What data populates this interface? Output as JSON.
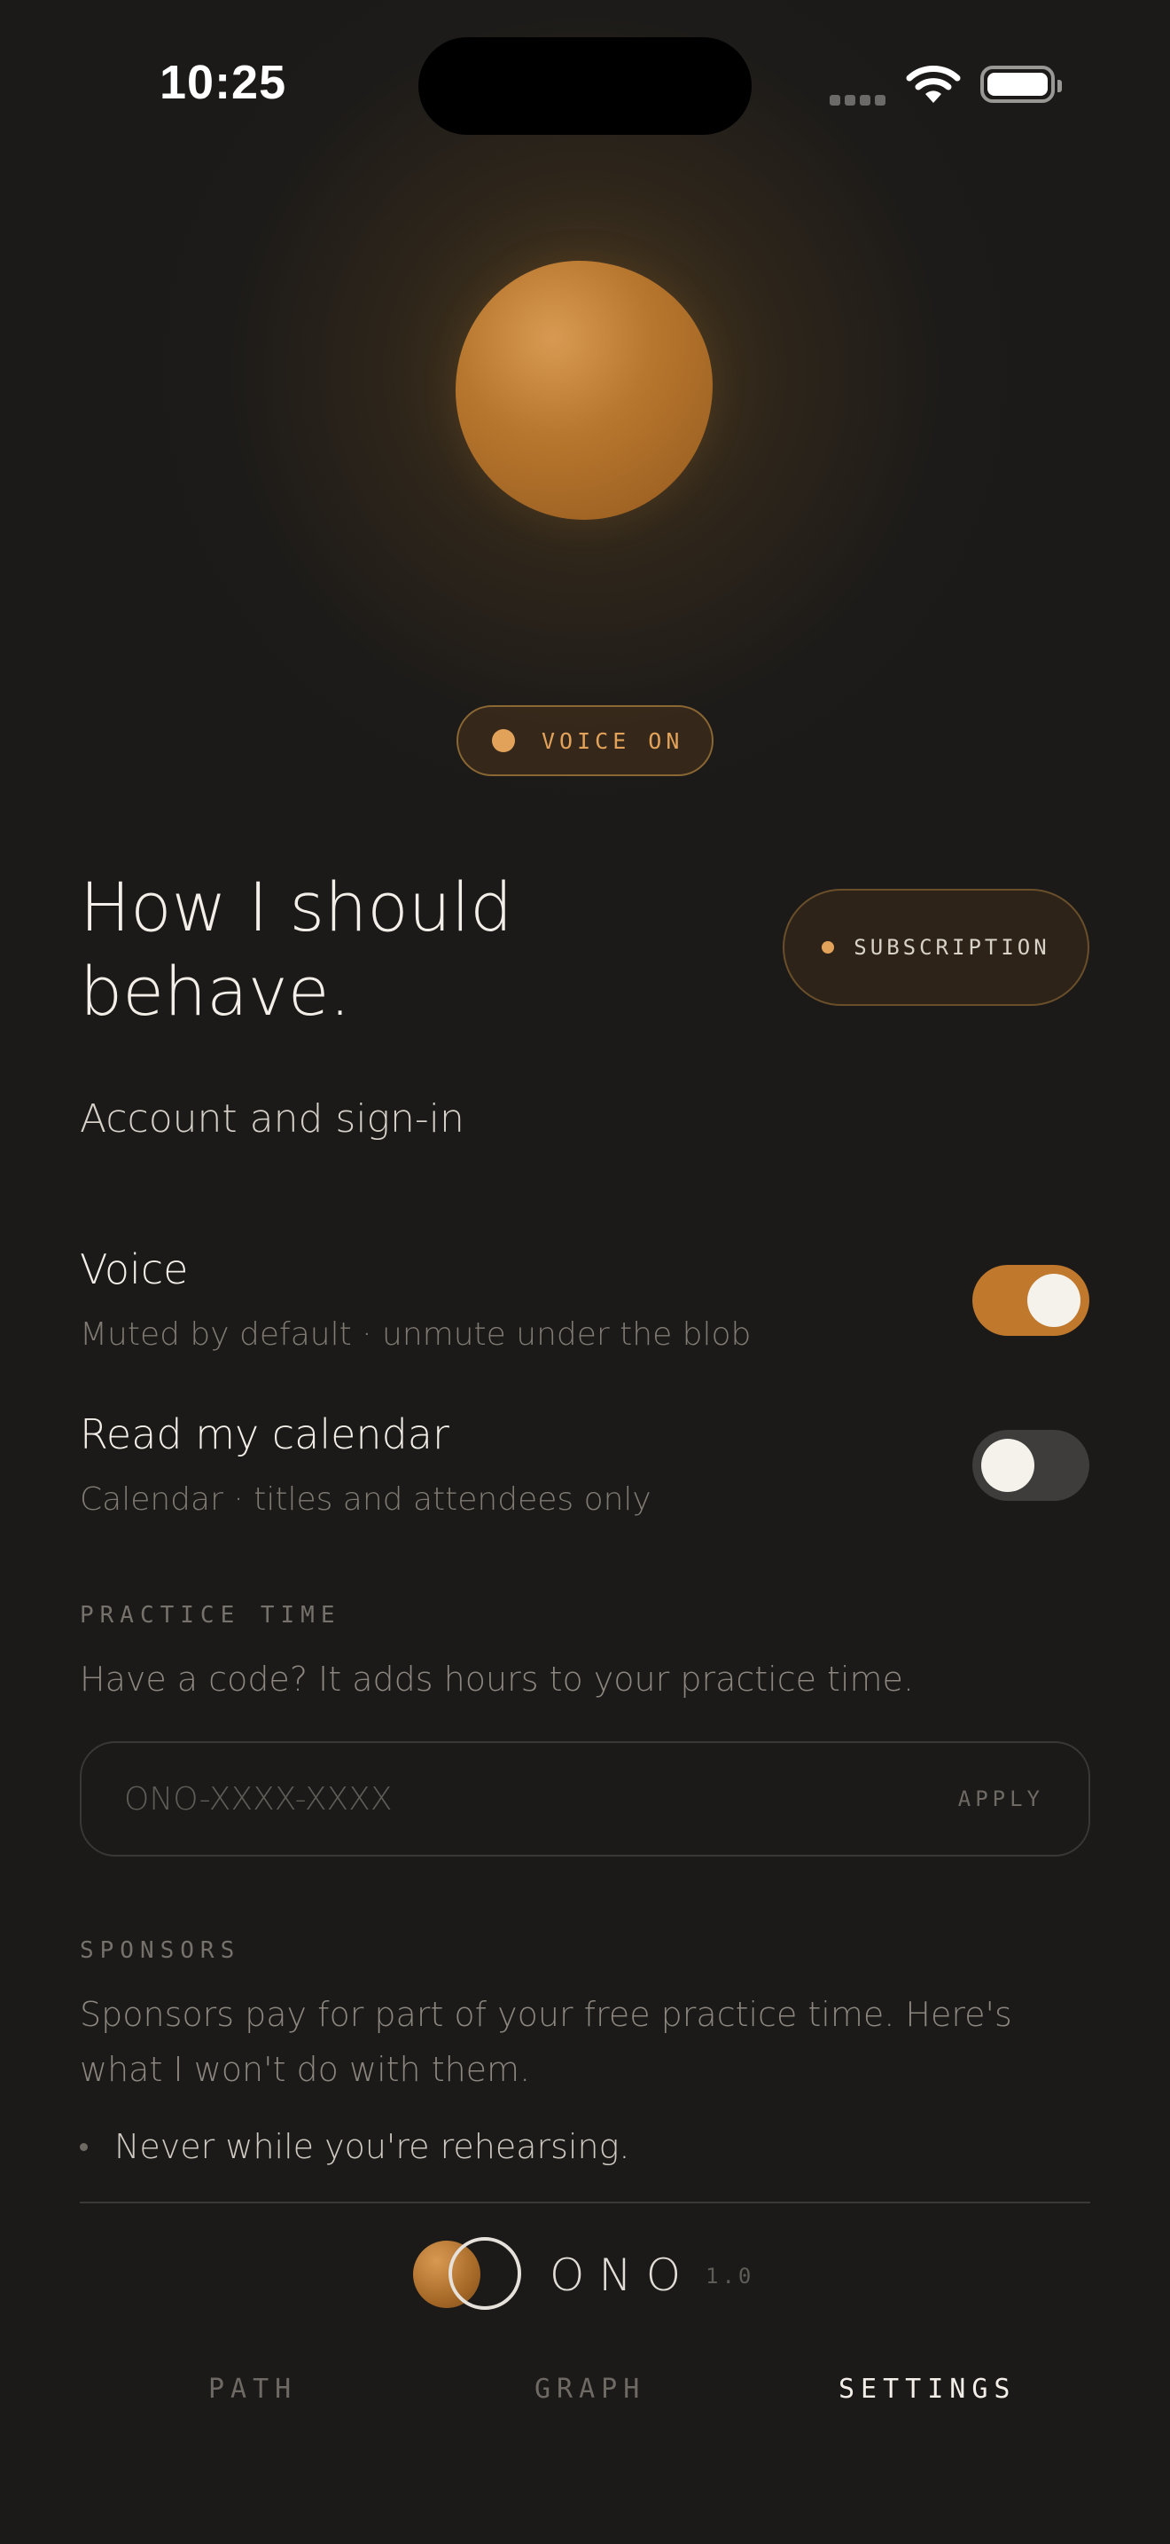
{
  "status_bar": {
    "time": "10:25"
  },
  "voice_pill": {
    "label": "VOICE ON",
    "accent": "#e3a25a"
  },
  "header": {
    "title": "How I should behave.",
    "subscription_label": "SUBSCRIPTION"
  },
  "account": {
    "label": "Account and sign-in"
  },
  "settings": {
    "voice": {
      "title": "Voice",
      "subtitle": "Muted by default · unmute under the blob",
      "on": true
    },
    "calendar": {
      "title": "Read my calendar",
      "subtitle": "Calendar · titles and attendees only",
      "on": false
    }
  },
  "practice": {
    "label": "PRACTICE TIME",
    "description": "Have a code? It adds hours to your practice time.",
    "placeholder": "ONO-XXXX-XXXX",
    "apply_label": "APPLY"
  },
  "sponsors": {
    "label": "SPONSORS",
    "description": "Sponsors pay for part of your free practice time. Here's what I won't do with them.",
    "items": [
      "Never while you're rehearsing."
    ]
  },
  "footer": {
    "brand": "ONO",
    "version": "1.0",
    "tabs": [
      {
        "label": "PATH",
        "active": false
      },
      {
        "label": "GRAPH",
        "active": false
      },
      {
        "label": "SETTINGS",
        "active": true
      }
    ]
  },
  "colors": {
    "background": "#1b1a19",
    "accent": "#c0782c",
    "toggle_off": "#3e3d3b"
  }
}
